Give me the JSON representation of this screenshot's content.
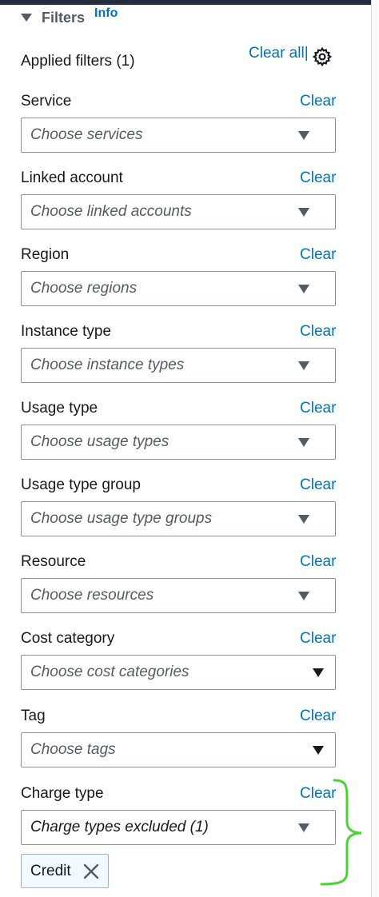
{
  "panel": {
    "title": "Filters",
    "info_link": "Info",
    "applied_filters": "Applied filters (1)",
    "clear_all": "Clear all|",
    "settings_icon": "gear-icon"
  },
  "filters": [
    {
      "label": "Service",
      "clear": "Clear",
      "placeholder": "Choose services"
    },
    {
      "label": "Linked account",
      "clear": "Clear",
      "placeholder": "Choose linked accounts"
    },
    {
      "label": "Region",
      "clear": "Clear",
      "placeholder": "Choose regions"
    },
    {
      "label": "Instance type",
      "clear": "Clear",
      "placeholder": "Choose instance types"
    },
    {
      "label": "Usage type",
      "clear": "Clear",
      "placeholder": "Choose usage types"
    },
    {
      "label": "Usage type group",
      "clear": "Clear",
      "placeholder": "Choose usage type groups"
    },
    {
      "label": "Resource",
      "clear": "Clear",
      "placeholder": "Choose resources"
    },
    {
      "label": "Cost category",
      "clear": "Clear",
      "placeholder": "Choose cost categories"
    },
    {
      "label": "Tag",
      "clear": "Clear",
      "placeholder": "Choose tags"
    },
    {
      "label": "Charge type",
      "clear": "Clear",
      "value": "Charge types excluded (1)"
    }
  ],
  "token": {
    "label": "Credit",
    "dismiss_icon": "close-icon"
  },
  "colors": {
    "link": "#0073bb",
    "text": "#16191f",
    "placeholder": "#545b64",
    "annotation": "#4cd137"
  }
}
